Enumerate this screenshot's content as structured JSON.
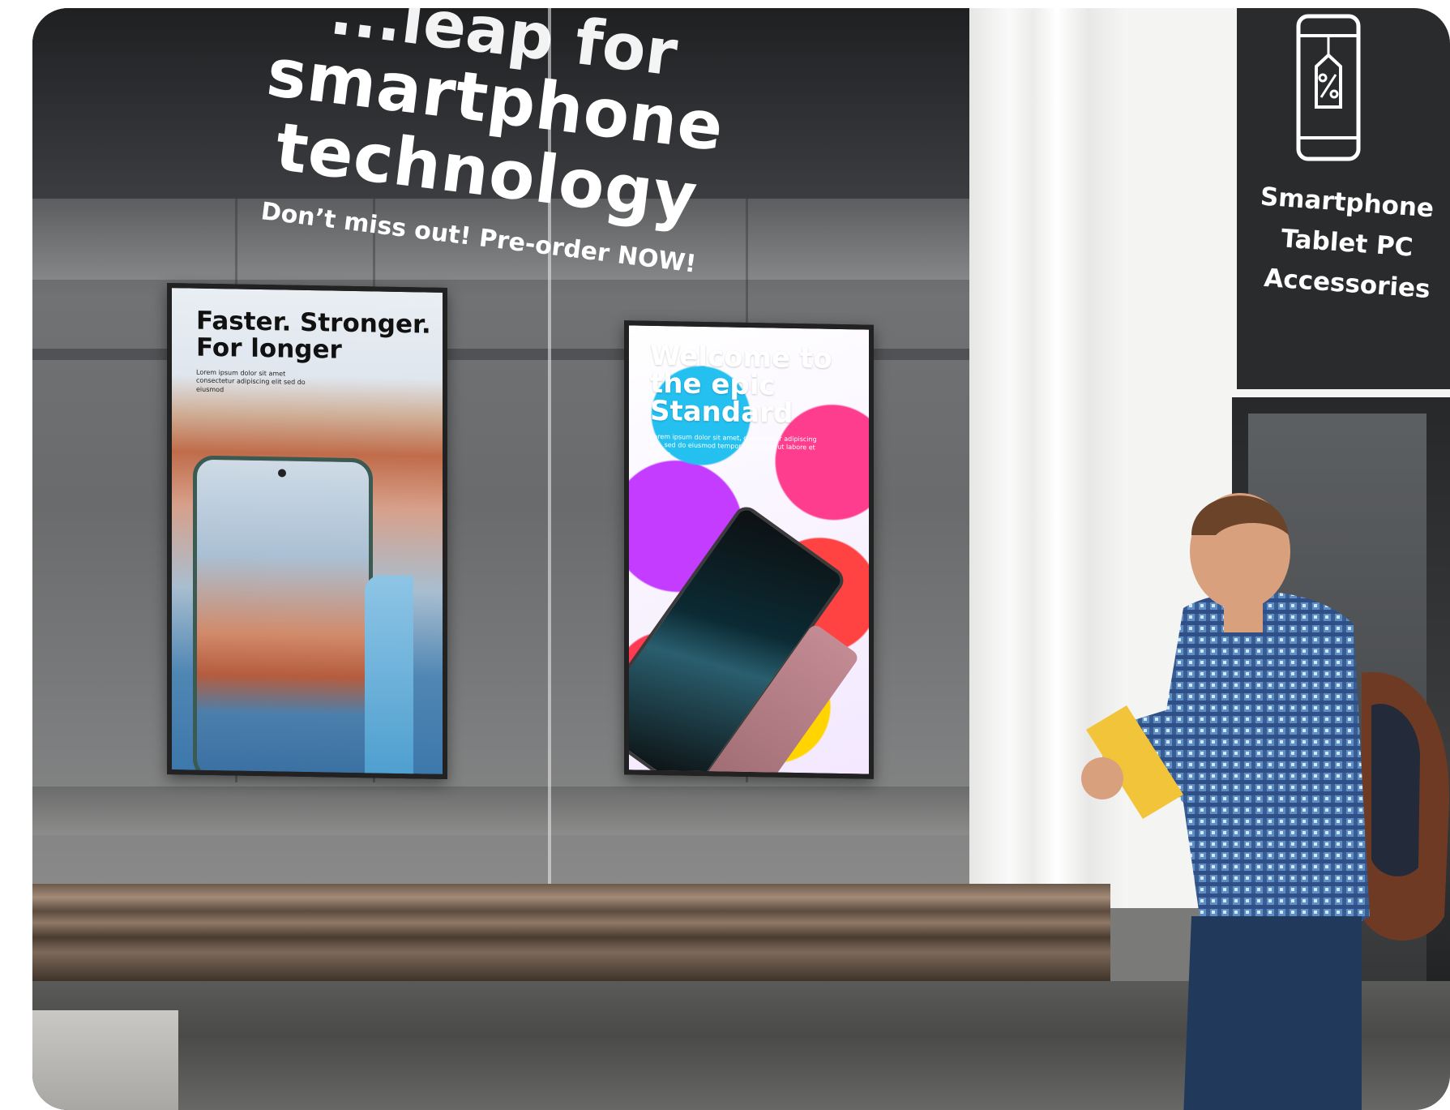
{
  "window_decal": {
    "headline_partial": "...leap for",
    "headline_main": "smartphone technology",
    "subline": "Don’t miss out! Pre-order NOW!"
  },
  "display_left": {
    "headline": "Faster. Stronger. For longer",
    "body": "Lorem ipsum dolor sit amet consectetur adipiscing elit sed do eiusmod"
  },
  "display_right": {
    "headline": "Welcome to the epic Standard",
    "body": "Lorem ipsum dolor sit amet, consectetur adipiscing elit, sed do eiusmod tempor incididunt ut labore et dolore"
  },
  "store_sign": {
    "icon": "phone-price-tag-icon",
    "lines": [
      "Smartphone",
      "Tablet PC",
      "Accessories"
    ]
  },
  "colors": {
    "sign_background": "#2a2b2c",
    "decal_text": "#ffffff"
  }
}
